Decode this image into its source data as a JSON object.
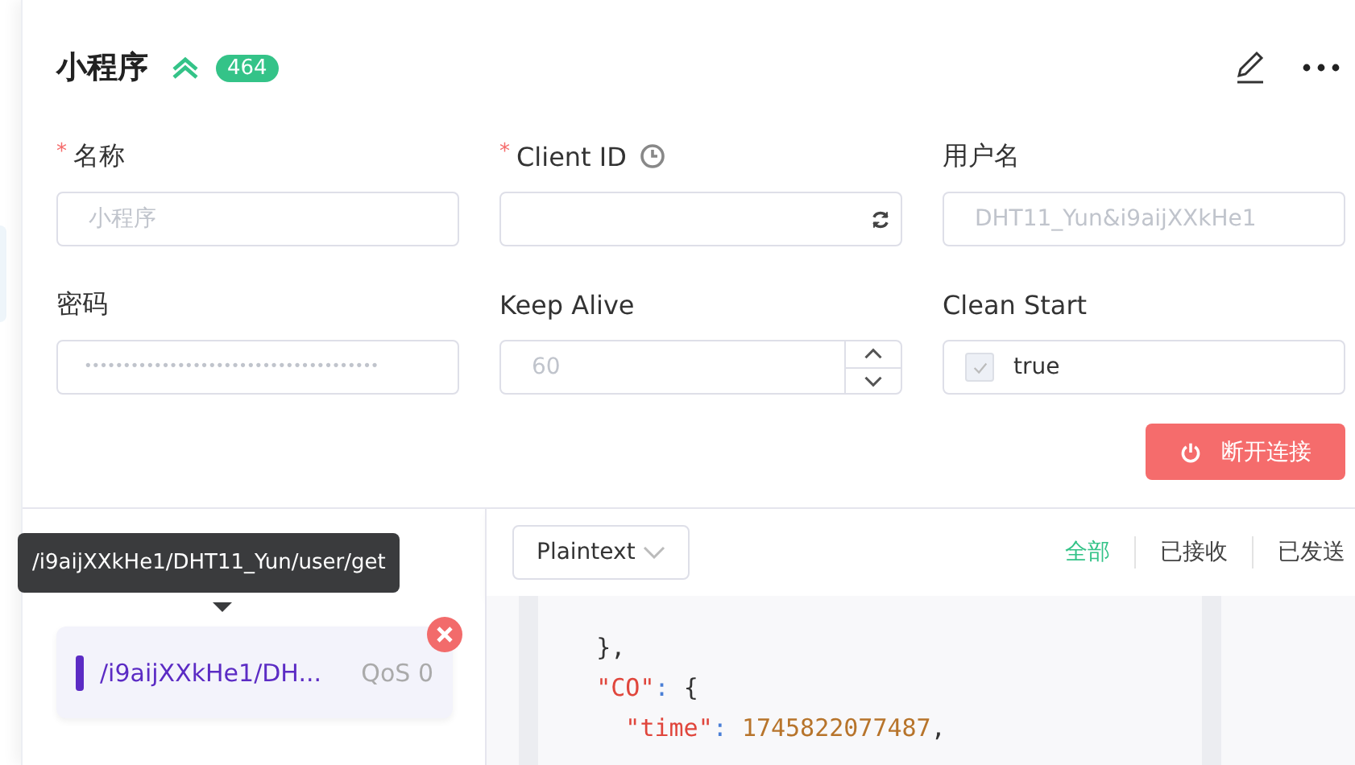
{
  "header": {
    "title": "小程序",
    "count": "464"
  },
  "fields": [
    {
      "kind": "text",
      "marker": "*",
      "label": "名称",
      "value": "小程序",
      "disabled": true
    },
    {
      "kind": "client",
      "marker": "*",
      "label": "Client ID",
      "disabled": true
    },
    {
      "kind": "text",
      "label": "用户名",
      "value": "DHT11_Yun&i9aijXXkHe1",
      "disabled": true
    },
    {
      "kind": "text",
      "label": "密码",
      "value": "••••••••••••••••••••••••••••••••••••••",
      "disabled": true
    },
    {
      "kind": "number",
      "label": "Keep Alive",
      "value": "60",
      "disabled": true
    },
    {
      "kind": "checkbox",
      "label": "Clean Start",
      "value": "true",
      "checked": true,
      "disabled": true
    }
  ],
  "disconnect_button": "断开连接",
  "tooltip": "/i9aijXXkHe1/DHT11_Yun/user/get",
  "subscriptions": [
    {
      "topic": "/i9aijXXkHe1/DH...",
      "qos": "QoS 0",
      "color": "#5b2bc4"
    }
  ],
  "payload_format": "Plaintext",
  "message_filters": [
    {
      "label": "全部",
      "selected": true
    },
    {
      "label": "已接收",
      "selected": false
    },
    {
      "label": "已发送",
      "selected": false
    }
  ],
  "code_lines": [
    [
      {
        "kind": "punct",
        "text": "    },"
      }
    ],
    [
      {
        "kind": "key",
        "text": "    \"CO\""
      },
      {
        "kind": "colon",
        "text": ": "
      },
      {
        "kind": "punct",
        "text": "{"
      }
    ],
    [
      {
        "kind": "key",
        "text": "      \"time\""
      },
      {
        "kind": "colon",
        "text": ": "
      },
      {
        "kind": "number",
        "text": "1745822077487"
      },
      {
        "kind": "punct",
        "text": ","
      }
    ]
  ]
}
